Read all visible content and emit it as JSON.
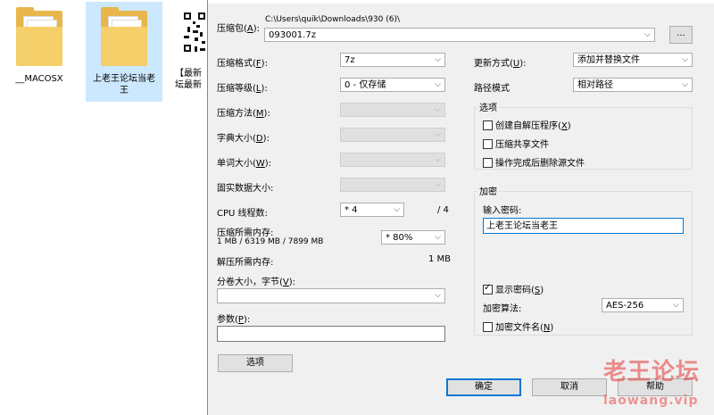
{
  "explorer": {
    "files": [
      {
        "name": "__MACOSX"
      },
      {
        "name": "上老王论坛当老王"
      },
      {
        "name": "【最新\n坛最新"
      }
    ]
  },
  "dialog": {
    "close_glyph": "✕",
    "archive_label": "压缩包(",
    "archive_key": "A",
    "archive_label_end": "):",
    "archive_path": "C:\\Users\\quik\\Downloads\\930 (6)\\",
    "archive_name": "093001.7z",
    "browse_label": "...",
    "format_label": "压缩格式(",
    "format_key": "F",
    "format_value": "7z",
    "level_label": "压缩等级(",
    "level_key": "L",
    "level_value": "0 - 仅存储",
    "method_label": "压缩方法(",
    "method_key": "M",
    "dict_label": "字典大小(",
    "dict_key": "D",
    "word_label": "单词大小(",
    "word_key": "W",
    "solid_label": "固实数据大小:",
    "cpu_label": "CPU 线程数:",
    "cpu_value": "* 4",
    "cpu_max": "/ 4",
    "mem_comp_label": "压缩所需内存:",
    "mem_comp_value": "1 MB / 6319 MB / 7899 MB",
    "mem_percent": "* 80%",
    "mem_decomp_label": "解压所需内存:",
    "mem_decomp_value": "1 MB",
    "split_label": "分卷大小，字节(",
    "split_key": "V",
    "params_label": "参数(",
    "params_key": "P",
    "options_btn": "选项",
    "update_label": "更新方式(",
    "update_key": "U",
    "update_value": "添加并替换文件",
    "path_label": "路径模式",
    "path_value": "相对路径",
    "options_group": "选项",
    "opt_sfx": "创建自解压程序(",
    "opt_sfx_key": "X",
    "opt_shared": "压缩共享文件",
    "opt_delete": "操作完成后删除源文件",
    "encrypt_group": "加密",
    "password_label": "输入密码:",
    "password_value": "上老王论坛当老王",
    "show_pwd": "显示密码(",
    "show_pwd_key": "S",
    "enc_method_label": "加密算法:",
    "enc_method_value": "AES-256",
    "enc_names": "加密文件名(",
    "enc_names_key": "N",
    "ok_btn": "确定",
    "cancel_btn": "取消",
    "help_btn": "帮助"
  },
  "watermark": {
    "title": "老王论坛",
    "site": "laowang.vip"
  }
}
